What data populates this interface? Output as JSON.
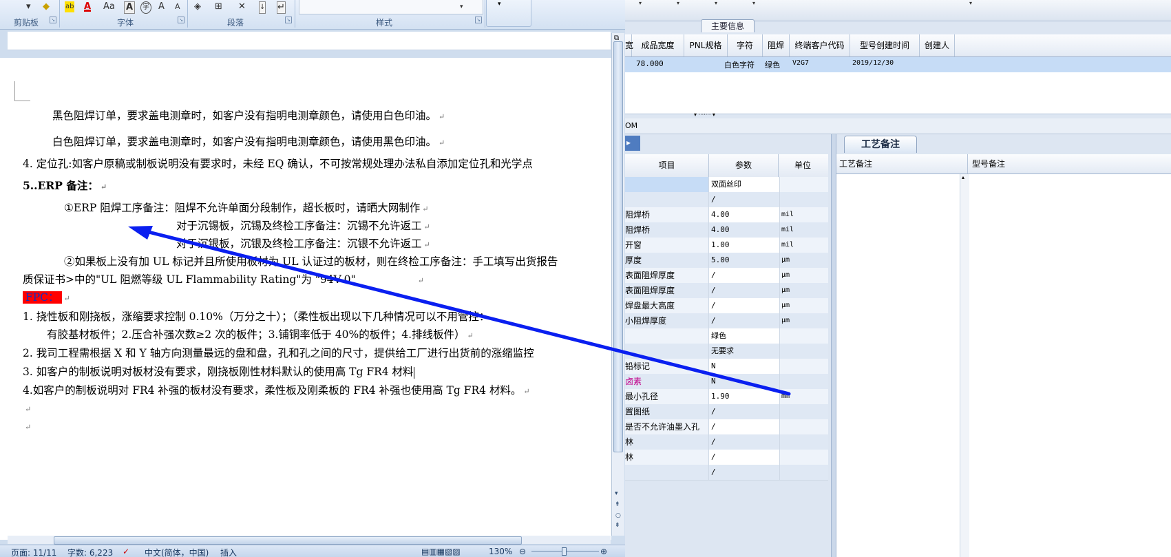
{
  "ribbon": {
    "groups": [
      "剪贴板",
      "字体",
      "段落",
      "样式"
    ],
    "font_icons": [
      "ab",
      "A",
      "Aa",
      "A",
      "字",
      "A",
      "A"
    ]
  },
  "document": {
    "lines": [
      "黑色阻焊订单，要求盖电测章时，如客户没有指明电测章颜色，请使用白色印油。",
      "白色阻焊订单，要求盖电测章时，如客户没有指明电测章颜色，请使用黑色印油。",
      "4.  定位孔:如客户原稿或制板说明没有要求时，未经 EQ 确认，不可按常规处理办法私自添加定位孔和光学点",
      "5..ERP 备注：",
      "①ERP 阻焊工序备注：阻焊不允许单面分段制作，超长板时，请晒大网制作",
      "对于沉锡板，沉锡及终检工序备注：沉锡不允许返工",
      "对于沉银板，沉银及终检工序备注：沉银不允许返工",
      "②如果板上没有加 UL 标记并且所使用板材为 UL 认证过的板材，则在终检工序备注：手工填写出货报告",
      "质保证书>中的\"UL 阻燃等级 UL Flammability Rating\"为 \"94V-0\"",
      "FPC：",
      "1.   挠性板和刚挠板，涨缩要求控制  0.10%（万分之十）；（柔性板出现以下几种情况可以不用管控：",
      "有胶基材板件；2.压合补强次数≥2 次的板件；3.铺铜率低于 40%的板件；4.排线板件）",
      "2.    我司工程需根据 X 和 Y 轴方向测量最远的盘和盘，孔和孔之间的尺寸，提供给工厂进行出货前的涨缩监控",
      "3.  如客户的制板说明对板材没有要求，刚挠板刚性材料默认的使用高 Tg  FR4 材料",
      " 4.如客户的制板说明对 FR4 补强的板材没有要求，柔性板及刚柔板的 FR4 补强也使用高 Tg  FR4 材料。"
    ],
    "return_mark": "↵"
  },
  "statusbar": {
    "page": "页面: 11/11",
    "words": "字数: 6,223",
    "language": "中文(简体，中国)",
    "mode": "插入",
    "zoom": "130%"
  },
  "erp": {
    "main_info_tab": "主要信息",
    "grid1_columns": [
      "宽",
      "成品宽度",
      "PNL规格",
      "字符",
      "阻焊",
      "终端客户代码",
      "型号创建时间",
      "创建人"
    ],
    "grid1_row": [
      "",
      "78.000",
      "",
      "白色字符",
      "绿色",
      "V2G7",
      "2019/12/30",
      ""
    ],
    "om_label": "OM",
    "param_columns": [
      "项目",
      "参数",
      "单位"
    ],
    "param_rows": [
      {
        "item": "",
        "value": "双面丝印",
        "unit": ""
      },
      {
        "item": "",
        "value": "/",
        "unit": ""
      },
      {
        "item": "阻焊桥",
        "value": "4.00",
        "unit": "mil"
      },
      {
        "item": "阻焊桥",
        "value": "4.00",
        "unit": "mil"
      },
      {
        "item": "开窗",
        "value": "1.00",
        "unit": "mil"
      },
      {
        "item": "厚度",
        "value": "5.00",
        "unit": "μm"
      },
      {
        "item": "表面阻焊厚度",
        "value": "/",
        "unit": "μm"
      },
      {
        "item": "表面阻焊厚度",
        "value": "/",
        "unit": "μm"
      },
      {
        "item": "焊盘最大高度",
        "value": "/",
        "unit": "μm"
      },
      {
        "item": "小阻焊厚度",
        "value": "/",
        "unit": "μm"
      },
      {
        "item": "",
        "value": "绿色",
        "unit": ""
      },
      {
        "item": "",
        "value": "无要求",
        "unit": ""
      },
      {
        "item": "铅标记",
        "value": "N",
        "unit": ""
      },
      {
        "item": "卤素",
        "value": "N",
        "unit": ""
      },
      {
        "item": "最小孔径",
        "value": "1.90",
        "unit": "mm"
      },
      {
        "item": "置图纸",
        "value": "/",
        "unit": ""
      },
      {
        "item": "是否不允许油墨入孔",
        "value": "/",
        "unit": ""
      },
      {
        "item": "林",
        "value": "/",
        "unit": ""
      },
      {
        "item": "林",
        "value": "/",
        "unit": ""
      },
      {
        "item": "",
        "value": "/",
        "unit": ""
      }
    ],
    "tech_tab": "工艺备注",
    "tech_columns": [
      "工艺备注",
      "型号备注"
    ]
  },
  "colors": {
    "arrow": "#0a1ff0",
    "fpc_bg": "#ff0000",
    "fpc_fg": "#1030c0",
    "halogen_label": "#c0008a",
    "selected_row": "#c6dcf6"
  }
}
